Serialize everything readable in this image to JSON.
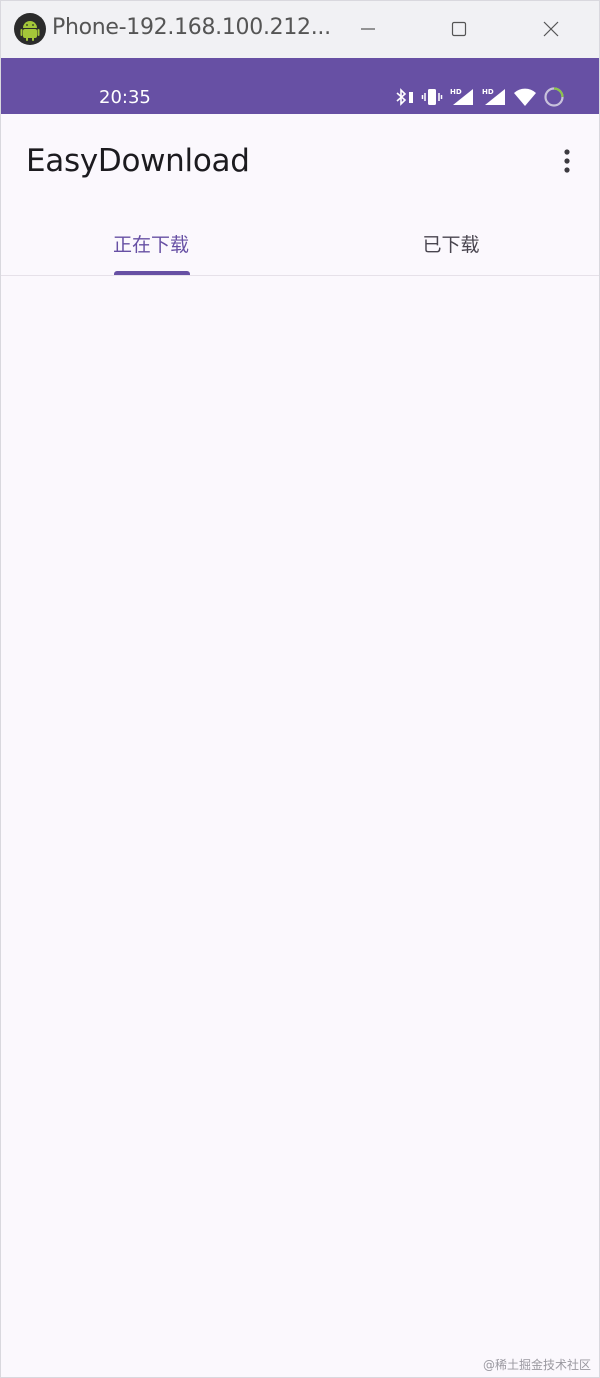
{
  "window": {
    "title": "Phone-192.168.100.212...",
    "icon": "android-icon",
    "controls": [
      "minimize-icon",
      "maximize-icon",
      "close-icon"
    ]
  },
  "statusbar": {
    "time": "20:35",
    "icons": [
      "bluetooth-icon",
      "vibrate-icon",
      "hd-signal-icon",
      "hd-signal-icon",
      "wifi-icon",
      "battery-ring-icon"
    ]
  },
  "appbar": {
    "title": "EasyDownload",
    "menu_icon": "more-vert-icon"
  },
  "tabs": [
    {
      "label": "正在下载",
      "active": true
    },
    {
      "label": "已下载",
      "active": false
    }
  ],
  "watermark": "@稀土掘金技术社区",
  "colors": {
    "primary": "#6750a4",
    "surface": "#fbf8fd",
    "on_surface": "#1c1b1f",
    "title_bar": "#f1f1f4"
  }
}
